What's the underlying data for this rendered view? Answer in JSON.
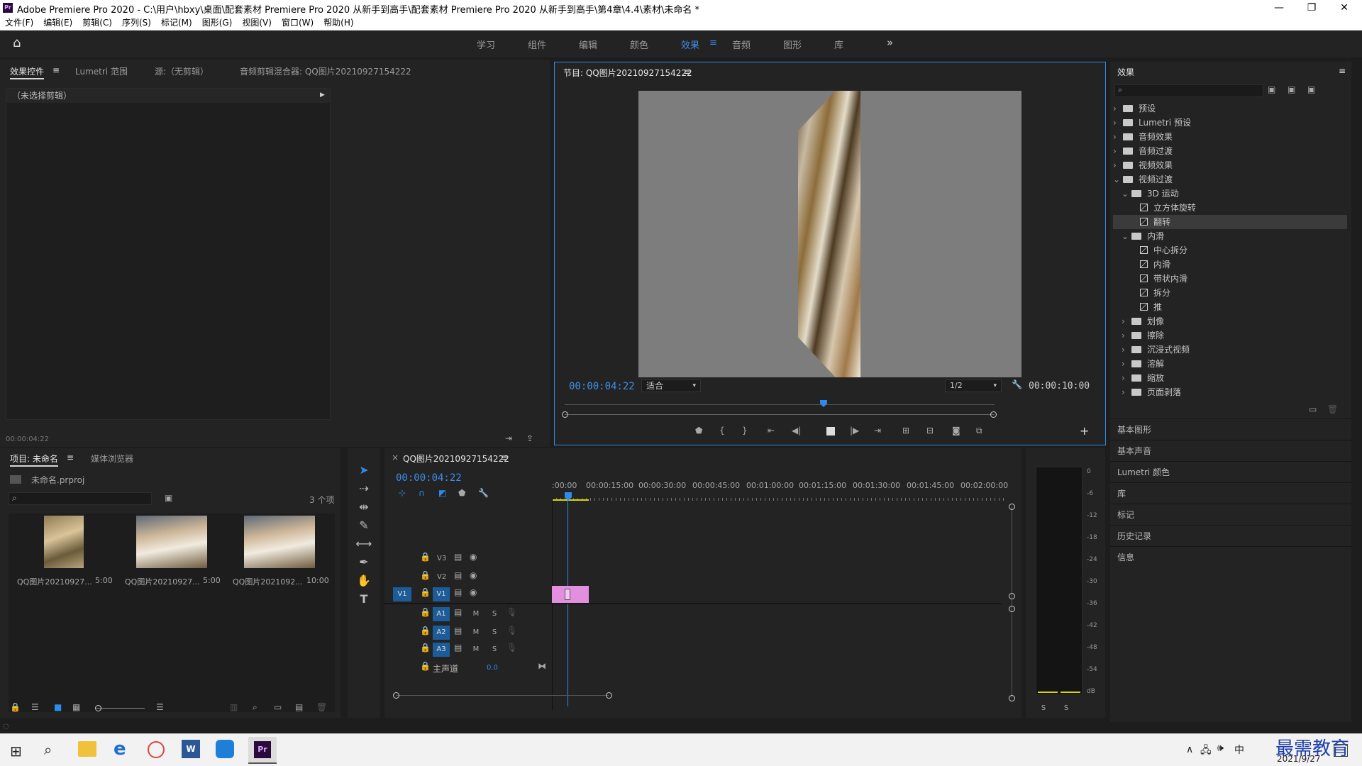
{
  "titlebar": {
    "app_title": "Adobe Premiere Pro 2020 - C:\\用户\\hbxy\\桌面\\配套素材 Premiere Pro 2020 从新手到高手\\配套素材 Premiere Pro 2020 从新手到高手\\第4章\\4.4\\素材\\未命名 *",
    "minimize": "—",
    "restore": "❐",
    "close": "✕"
  },
  "menu": [
    "文件(F)",
    "编辑(E)",
    "剪辑(C)",
    "序列(S)",
    "标记(M)",
    "图形(G)",
    "视图(V)",
    "窗口(W)",
    "帮助(H)"
  ],
  "workspaces": {
    "items": [
      "学习",
      "组件",
      "编辑",
      "颜色",
      "效果",
      "音频",
      "图形",
      "库"
    ],
    "active": "效果",
    "overflow": "»",
    "active_menu": "≡"
  },
  "effect_controls": {
    "tabs": [
      "效果控件",
      "Lumetri 范围",
      "源:（无剪辑）",
      "音频剪辑混合器: QQ图片20210927154222"
    ],
    "tab_menu": "≡",
    "no_clip": "（未选择剪辑）",
    "time": "00:00:04:22"
  },
  "program": {
    "title": "节目: QQ图片20210927154222",
    "menu": "≡",
    "timecode": "00:00:04:22",
    "fit": "适合",
    "resolution": "1/2",
    "duration": "00:00:10:00"
  },
  "effects": {
    "title": "效果",
    "menu": "≡",
    "search_placeholder": "",
    "tree": [
      {
        "label": "预设",
        "level": 0,
        "type": "folder",
        "open": false
      },
      {
        "label": "Lumetri 预设",
        "level": 0,
        "type": "folder",
        "open": false
      },
      {
        "label": "音频效果",
        "level": 0,
        "type": "folder",
        "open": false
      },
      {
        "label": "音频过渡",
        "level": 0,
        "type": "folder",
        "open": false
      },
      {
        "label": "视频效果",
        "level": 0,
        "type": "folder",
        "open": false
      },
      {
        "label": "视频过渡",
        "level": 0,
        "type": "folder",
        "open": true
      },
      {
        "label": "3D 运动",
        "level": 1,
        "type": "folder",
        "open": true
      },
      {
        "label": "立方体旋转",
        "level": 2,
        "type": "fx"
      },
      {
        "label": "翻转",
        "level": 2,
        "type": "fx",
        "selected": true
      },
      {
        "label": "内滑",
        "level": 1,
        "type": "folder",
        "open": true
      },
      {
        "label": "中心拆分",
        "level": 2,
        "type": "fx"
      },
      {
        "label": "内滑",
        "level": 2,
        "type": "fx"
      },
      {
        "label": "带状内滑",
        "level": 2,
        "type": "fx"
      },
      {
        "label": "拆分",
        "level": 2,
        "type": "fx"
      },
      {
        "label": "推",
        "level": 2,
        "type": "fx"
      },
      {
        "label": "划像",
        "level": 1,
        "type": "folder",
        "open": false
      },
      {
        "label": "擦除",
        "level": 1,
        "type": "folder",
        "open": false
      },
      {
        "label": "沉浸式视频",
        "level": 1,
        "type": "folder",
        "open": false
      },
      {
        "label": "溶解",
        "level": 1,
        "type": "folder",
        "open": false
      },
      {
        "label": "缩放",
        "level": 1,
        "type": "folder",
        "open": false
      },
      {
        "label": "页面剥落",
        "level": 1,
        "type": "folder",
        "open": false
      }
    ]
  },
  "side_panels": [
    "基本图形",
    "基本声音",
    "Lumetri 颜色",
    "库",
    "标记",
    "历史记录",
    "信息"
  ],
  "project": {
    "tabs": [
      "项目: 未命名",
      "媒体浏览器"
    ],
    "tab_menu": "≡",
    "file": "未命名.prproj",
    "count": "3 个项",
    "items": [
      {
        "name": "QQ图片20210927...",
        "dur": "5:00"
      },
      {
        "name": "QQ图片20210927...",
        "dur": "5:00"
      },
      {
        "name": "QQ图片2021092...",
        "dur": "10:00"
      }
    ]
  },
  "timeline": {
    "title": "QQ图片20210927154222",
    "menu": "≡",
    "close": "×",
    "timecode": "00:00:04:22",
    "ruler": [
      ":00:00",
      "00:00:15:00",
      "00:00:30:00",
      "00:00:45:00",
      "00:01:00:00",
      "00:01:15:00",
      "00:01:30:00",
      "00:01:45:00",
      "00:02:00:00"
    ],
    "video_tracks": [
      "V3",
      "V2",
      "V1"
    ],
    "source_patch": "V1",
    "audio_tracks": [
      "A1",
      "A2",
      "A3"
    ],
    "mute": "M",
    "solo": "S",
    "master": "主声道",
    "master_val": "0.0"
  },
  "meter": {
    "scale": [
      "0",
      "-6",
      "-12",
      "-18",
      "-24",
      "-30",
      "-36",
      "-42",
      "-48",
      "-54",
      "dB"
    ],
    "solo": [
      "S",
      "S"
    ]
  },
  "taskbar": {
    "date": "2021/9/27",
    "ime": "中",
    "watermark": "最需教育"
  },
  "colors": {
    "accent": "#2d8ceb",
    "clip": "#e28fe0",
    "panel": "#232323"
  }
}
